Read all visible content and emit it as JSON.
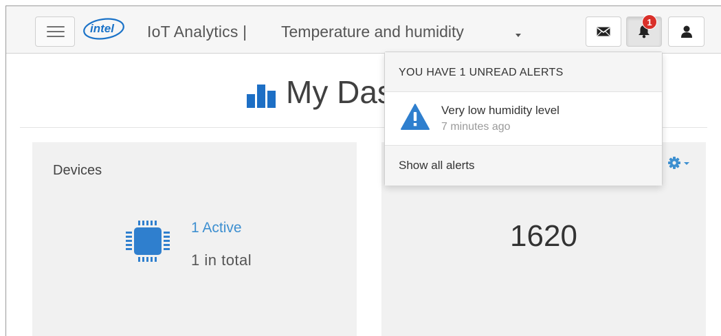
{
  "navbar": {
    "logo_text": "intel",
    "app_title": "IoT Analytics |",
    "project": "Temperature and humidity",
    "notification_count": "1"
  },
  "page": {
    "heading": "My Dashboard"
  },
  "cards": {
    "devices": {
      "title": "Devices",
      "active": "1 Active",
      "total": "1 in total"
    },
    "count": {
      "value": "1620"
    }
  },
  "alerts_dropdown": {
    "header": "YOU HAVE 1 UNREAD ALERTS",
    "items": [
      {
        "message": "Very low humidity level",
        "time": "7 minutes ago"
      }
    ],
    "footer": "Show all alerts"
  },
  "colors": {
    "accent_blue": "#3d8fd0",
    "logo_blue": "#1b73c8",
    "badge_red": "#d9302a",
    "card_bg": "#f1f1f1"
  },
  "icons": {
    "menu": "hamburger-icon",
    "mail": "envelope-icon",
    "alerts": "bell-icon",
    "user": "user-icon",
    "heading": "bar-chart-icon",
    "device": "chip-icon",
    "settings": "gear-icon",
    "alert_item": "warning-icon"
  }
}
